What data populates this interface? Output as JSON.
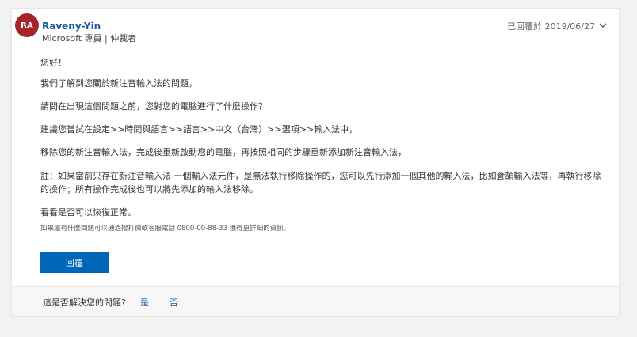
{
  "author": {
    "avatar_initials": "RA",
    "name": "Raveny-Yin",
    "role": "Microsoft 專員 | 仲裁者"
  },
  "reply": {
    "date": "已回覆於 2019/06/27",
    "paragraphs": [
      "您好！",
      "我們了解到您關於新注音輸入法的問題，",
      "請問在出現這個問題之前，您對您的電腦進行了什麼操作？",
      "建議您嘗試在設定>>時間與語言>>語言>>中文（台灣）>>選項>>輸入法中，",
      "移除您的新注音輸入法，完成後重新啟動您的電腦，再按照相同的步驟重新添加新注音輸入法，",
      "註：如果當前只存在新注音輸入法 一個輸入法元件，是無法執行移除操作的，您可以先行添加一個其他的輸入法，比如倉頡輸入法等，再執行移除的操作；所有操作完成後也可以將先添加的輸入法移除。",
      "看看是否可以恢復正常。"
    ],
    "small_note": "如果還有什麼問題可以通過撥打微軟客服電話 0800-00-88-33 獲得更詳細的資訊。",
    "reply_button_label": "回覆"
  },
  "footer": {
    "question": "這是否解決您的問題?",
    "yes_label": "是",
    "no_label": "否"
  },
  "colors": {
    "accent": "#0067b8",
    "avatar_bg": "#a4262c",
    "link": "#1a5aa6"
  },
  "icons": {
    "expand": "chevron-down-icon"
  }
}
